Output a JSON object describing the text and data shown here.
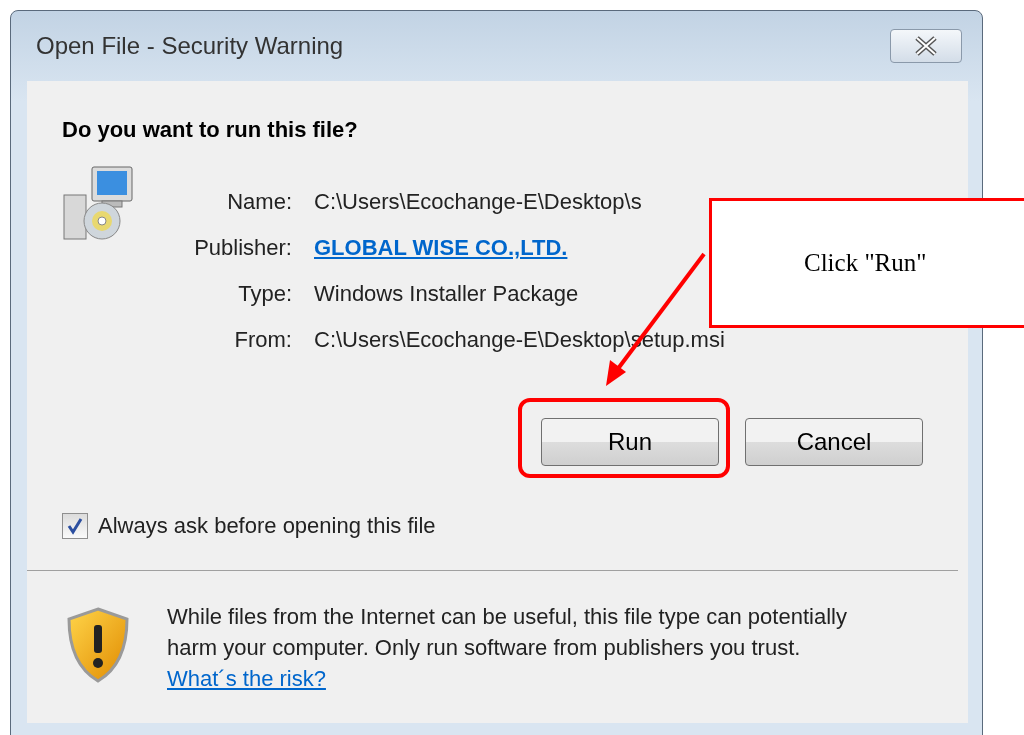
{
  "window": {
    "title": "Open File - Security Warning"
  },
  "heading": "Do you want to run this file?",
  "details": [
    {
      "label": "Name:",
      "value": "C:\\Users\\Ecochange-E\\Desktop\\s",
      "kind": "text"
    },
    {
      "label": "Publisher:",
      "value": "GLOBAL WISE CO.,LTD.",
      "kind": "link"
    },
    {
      "label": "Type:",
      "value": "Windows Installer Package",
      "kind": "text"
    },
    {
      "label": "From:",
      "value": "C:\\Users\\Ecochange-E\\Desktop\\setup.msi",
      "kind": "text"
    }
  ],
  "buttons": [
    {
      "label": "Run"
    },
    {
      "label": "Cancel"
    }
  ],
  "always_ask": {
    "label": "Always ask before opening this file",
    "checked": true
  },
  "warning": {
    "text": "While files from the Internet can be useful, this file type can potentially harm your computer. Only run software from publishers you trust.",
    "link": "What´s the risk?"
  },
  "annotation": {
    "text": "Click \"Run\""
  }
}
